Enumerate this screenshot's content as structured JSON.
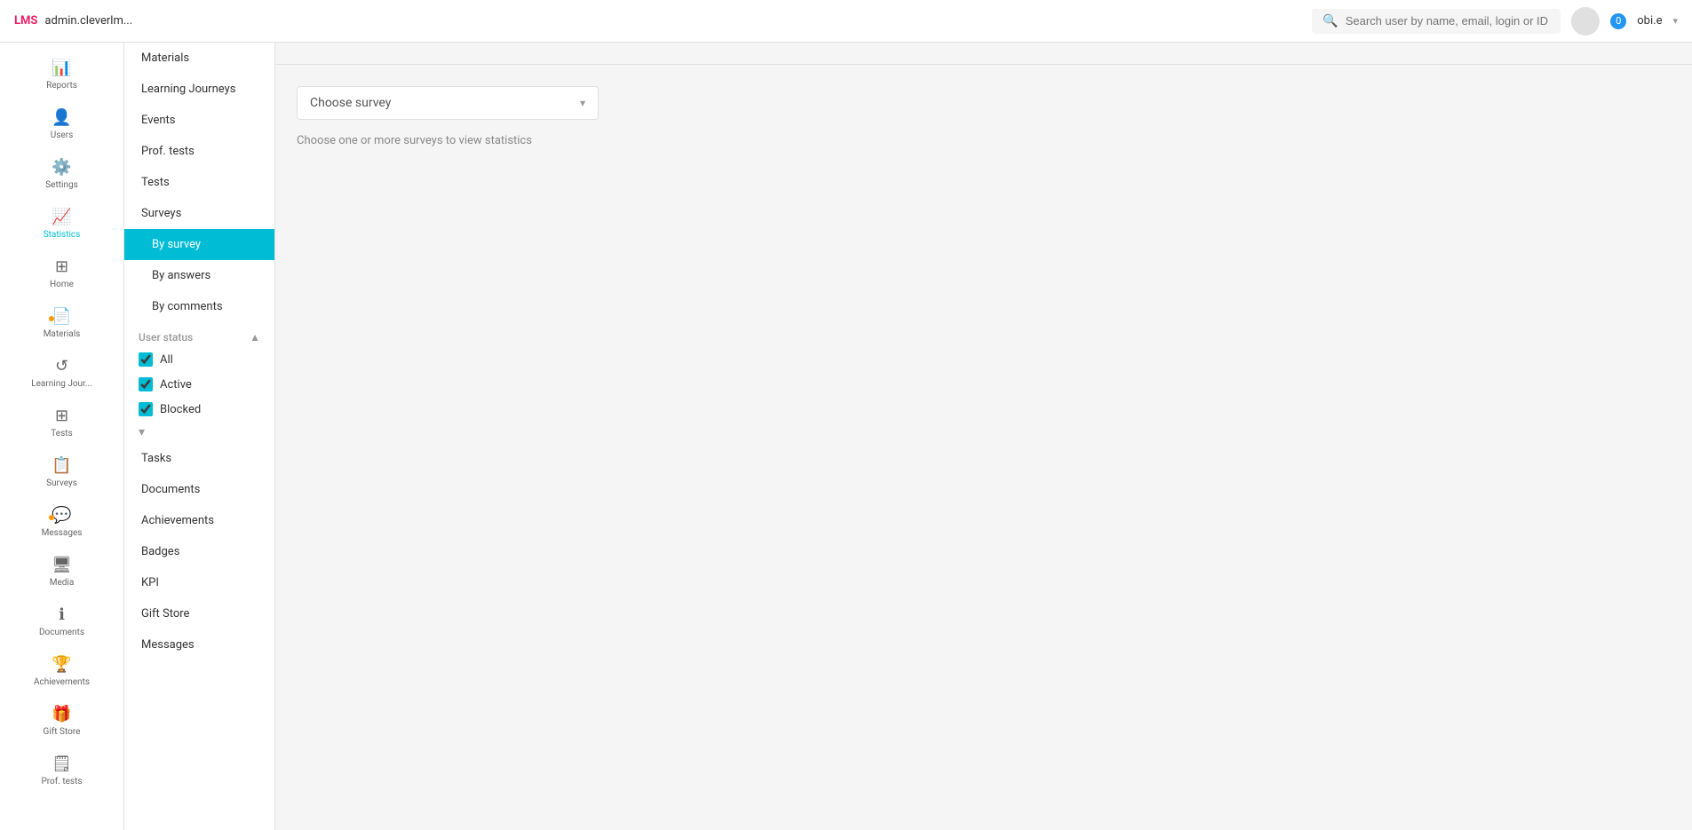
{
  "topbar": {
    "logo": "LMS",
    "admin": "admin.cleverlm...",
    "search_placeholder": "Search user by name, email, login or ID",
    "notification_count": "0",
    "user_name": "obi.e"
  },
  "sidebar_icons": [
    {
      "id": "reports",
      "label": "Reports",
      "icon": "📊",
      "active": false
    },
    {
      "id": "users",
      "label": "Users",
      "icon": "👤",
      "active": false
    },
    {
      "id": "settings",
      "label": "Settings",
      "icon": "⚙️",
      "active": false
    },
    {
      "id": "statistics",
      "label": "Statistics",
      "icon": "📈",
      "active": true
    },
    {
      "id": "home",
      "label": "Home",
      "icon": "⊞",
      "active": false
    },
    {
      "id": "materials",
      "label": "Materials",
      "icon": "📄",
      "active": false,
      "dot": true
    },
    {
      "id": "learning-journeys",
      "label": "Learning Jour...",
      "icon": "🔄",
      "active": false
    },
    {
      "id": "tests",
      "label": "Tests",
      "icon": "⊞",
      "active": false
    },
    {
      "id": "surveys",
      "label": "Surveys",
      "icon": "📋",
      "active": false
    },
    {
      "id": "messages",
      "label": "Messages",
      "icon": "📩",
      "active": false,
      "dot": true
    },
    {
      "id": "media",
      "label": "Media",
      "icon": "🖥",
      "active": false
    },
    {
      "id": "documents",
      "label": "Documents",
      "icon": "ℹ️",
      "active": false
    },
    {
      "id": "achievements",
      "label": "Achievements",
      "icon": "🏆",
      "active": false
    },
    {
      "id": "gift-store",
      "label": "Gift Store",
      "icon": "🎁",
      "active": false
    },
    {
      "id": "prof-tests",
      "label": "Prof. tests",
      "icon": "📋",
      "active": false
    }
  ],
  "sidebar_sub": {
    "items": [
      {
        "id": "materials",
        "label": "Materials",
        "active": false
      },
      {
        "id": "learning-journeys",
        "label": "Learning Journeys",
        "active": false
      },
      {
        "id": "events",
        "label": "Events",
        "active": false
      },
      {
        "id": "prof-tests",
        "label": "Prof. tests",
        "active": false
      },
      {
        "id": "tests",
        "label": "Tests",
        "active": false
      },
      {
        "id": "surveys",
        "label": "Surveys",
        "active": false
      },
      {
        "id": "tasks",
        "label": "Tasks",
        "active": false
      },
      {
        "id": "documents",
        "label": "Documents",
        "active": false
      },
      {
        "id": "achievements",
        "label": "Achievements",
        "active": false
      },
      {
        "id": "badges",
        "label": "Badges",
        "active": false
      },
      {
        "id": "kpi",
        "label": "KPI",
        "active": false
      },
      {
        "id": "gift-store",
        "label": "Gift Store",
        "active": false
      },
      {
        "id": "messages",
        "label": "Messages",
        "active": false
      }
    ],
    "survey_sub_items": [
      {
        "id": "by-survey",
        "label": "By survey",
        "active": true
      },
      {
        "id": "by-answers",
        "label": "By answers",
        "active": false
      },
      {
        "id": "by-comments",
        "label": "By comments",
        "active": false
      }
    ],
    "user_status": {
      "label": "User status",
      "checkboxes": [
        {
          "id": "all",
          "label": "All",
          "checked": true
        },
        {
          "id": "active",
          "label": "Active",
          "checked": true
        },
        {
          "id": "blocked",
          "label": "Blocked",
          "checked": true
        }
      ]
    }
  },
  "main": {
    "choose_survey_label": "Choose survey",
    "hint_text": "Choose one or more surveys to view statistics"
  }
}
